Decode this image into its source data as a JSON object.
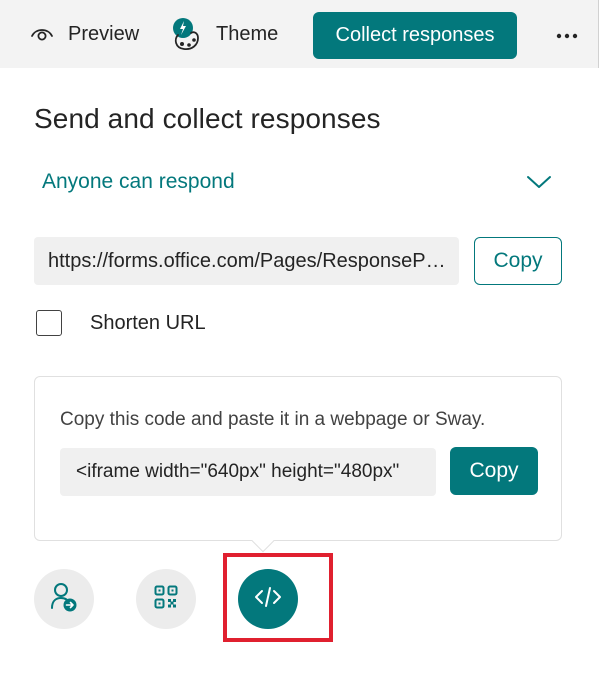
{
  "toolbar": {
    "preview_label": "Preview",
    "theme_label": "Theme",
    "collect_label": "Collect responses",
    "more_icon": "more-horizontal-icon",
    "accent_color": "#03787c"
  },
  "panel": {
    "title": "Send and collect responses",
    "audience_label": "Anyone can respond",
    "url_value": "https://forms.office.com/Pages/ResponsePage.aspx",
    "copy_label": "Copy",
    "shorten_label": "Shorten URL",
    "shorten_checked": false
  },
  "embed": {
    "description": "Copy this code and paste it in a webpage or Sway.",
    "code_value": "<iframe width=\"640px\" height=\"480px\"",
    "copy_label": "Copy"
  },
  "share_options": [
    {
      "name": "share-with-people",
      "icon": "person-arrow-icon",
      "selected": false
    },
    {
      "name": "qr-code",
      "icon": "qr-code-icon",
      "selected": false
    },
    {
      "name": "embed",
      "icon": "code-icon",
      "selected": true
    }
  ],
  "highlight_color": "#e0202f"
}
